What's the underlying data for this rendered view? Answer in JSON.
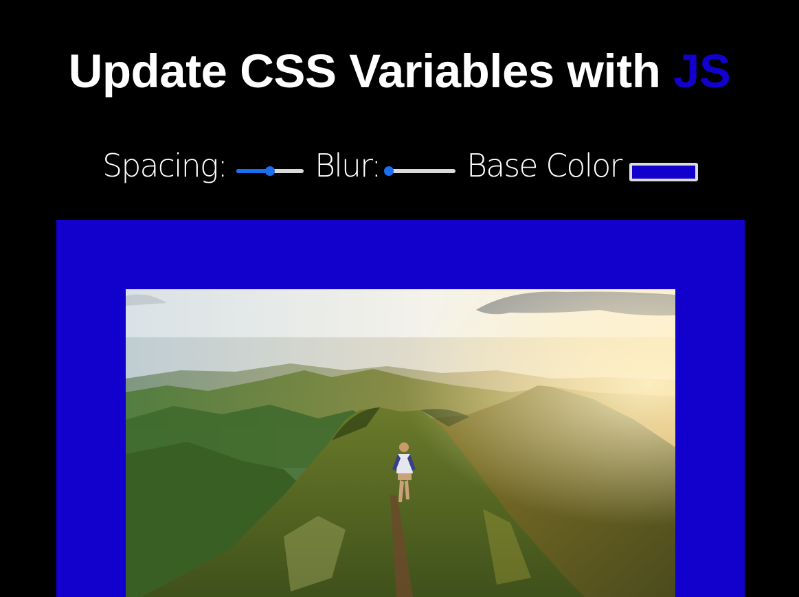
{
  "header": {
    "title_main": "Update CSS Variables with ",
    "title_highlight": "JS"
  },
  "controls": {
    "spacing": {
      "label": "Spacing:",
      "value_fraction": 0.5
    },
    "blur": {
      "label": "Blur:",
      "value_fraction": 0.0
    },
    "base_color": {
      "label": "Base Color",
      "value": "#1200cc"
    }
  },
  "colors": {
    "background": "#000000",
    "accent": "#1200cc",
    "slider_active": "#1a6ff0",
    "slider_track": "#d9d9d9"
  },
  "image": {
    "subject": "hiker walking along a grassy mountain ridge at sunrise"
  }
}
